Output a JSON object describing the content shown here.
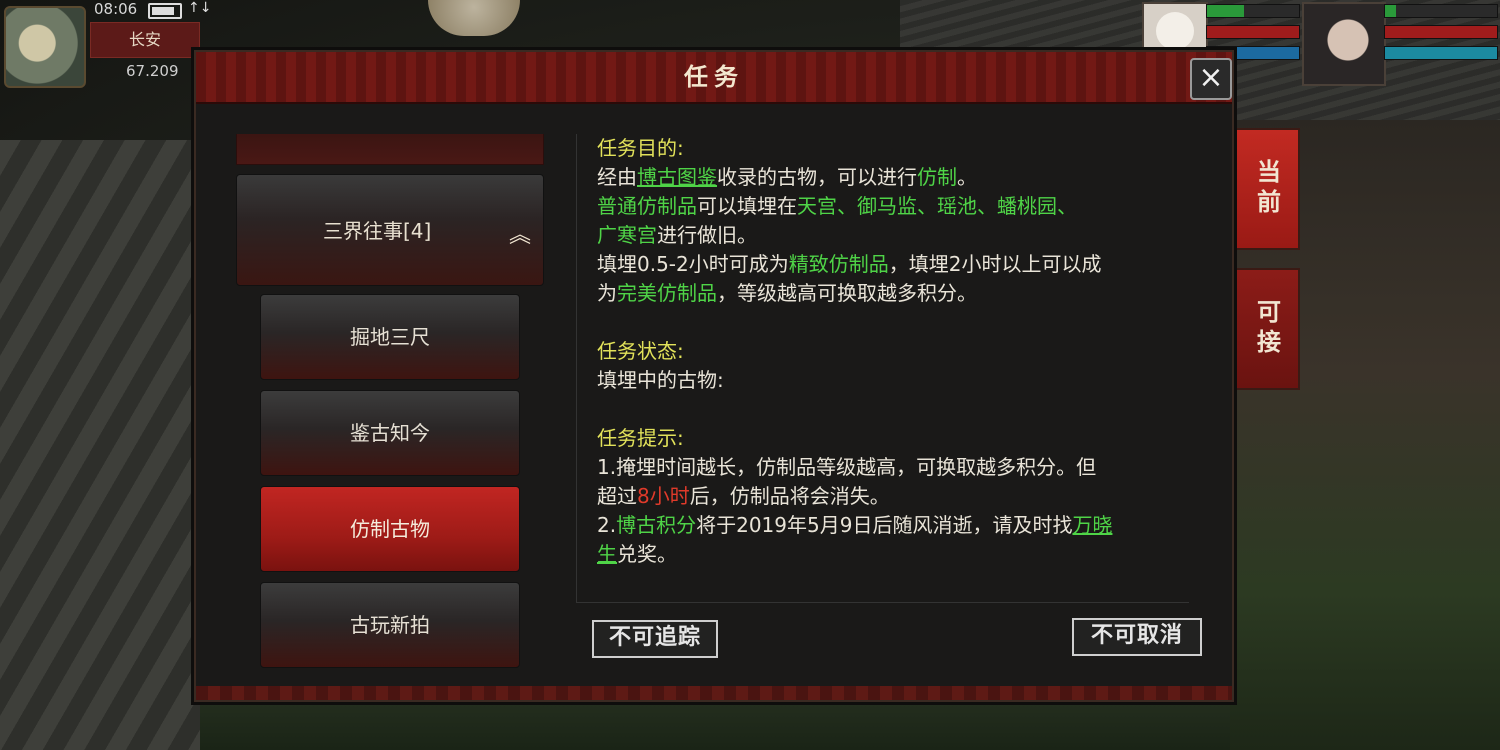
{
  "hud": {
    "time": "08:06",
    "signal": "↑↓",
    "location": "长安",
    "coordinate": "67.209"
  },
  "side_tabs": [
    {
      "label": "当前",
      "active": true
    },
    {
      "label": "可接",
      "active": false
    }
  ],
  "panel": {
    "title": "任务",
    "close_icon": "×"
  },
  "left_list": {
    "category": {
      "label": "三界往事[4]",
      "icon": "chevron-up"
    },
    "items": [
      {
        "label": "掘地三尺",
        "active": false
      },
      {
        "label": "鉴古知今",
        "active": false
      },
      {
        "label": "仿制古物",
        "active": true
      },
      {
        "label": "古玩新拍",
        "active": false
      }
    ]
  },
  "content": {
    "goal_title": "任务目的:",
    "goal_l1_a": "经由",
    "goal_l1_link": "博古图鉴",
    "goal_l1_b": "收录的古物，可以进行",
    "goal_l1_c": "仿制",
    "goal_l1_d": "。",
    "goal_l2_a": "普通仿制品",
    "goal_l2_b": "可以填埋在",
    "goal_l2_c": "天宫、御马监、瑶池、蟠桃园、",
    "goal_l3_a": "广寒宫",
    "goal_l3_b": "进行做旧。",
    "goal_l4_a": "填埋0.5-2小时可成为",
    "goal_l4_b": "精致仿制品",
    "goal_l4_c": "，填埋2小时以上可以成",
    "goal_l5_a": "为",
    "goal_l5_b": "完美仿制品",
    "goal_l5_c": "，等级越高可换取越多积分。",
    "status_title": "任务状态:",
    "status_l1": "填埋中的古物:",
    "tips_title": "任务提示:",
    "tip1_a": "1.掩埋时间越长，仿制品等级越高，可换取越多积分。但",
    "tip1_b": "超过",
    "tip1_c": "8小时",
    "tip1_d": "后，仿制品将会消失。",
    "tip2_a": "2.",
    "tip2_b": "博古积分",
    "tip2_c": "将于2019年5月9日后随风消逝，请及时找",
    "tip2_d": "万晓",
    "tip3_a": "生",
    "tip3_b": "兑奖。"
  },
  "buttons": {
    "track": "不可追踪",
    "cancel": "不可取消"
  },
  "colors": {
    "section_title": "#e2e25a",
    "highlight_green": "#4fd447",
    "highlight_red": "#e03a2a",
    "active_tab": "#c22a22"
  }
}
